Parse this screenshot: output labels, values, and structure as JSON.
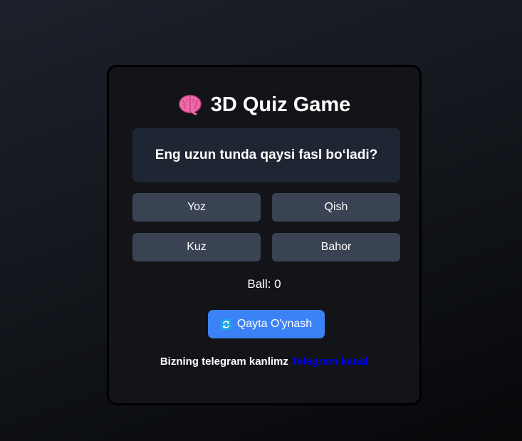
{
  "app": {
    "title": "3D Quiz Game",
    "title_icon": "brain-icon"
  },
  "question": {
    "text": "Eng uzun tunda qaysi fasl bo‘ladi?"
  },
  "answers": [
    {
      "label": "Yoz"
    },
    {
      "label": "Qish"
    },
    {
      "label": "Kuz"
    },
    {
      "label": "Bahor"
    }
  ],
  "score": {
    "text": "Ball: 0"
  },
  "restart": {
    "label": "Qayta O'ynash",
    "icon": "refresh-icon"
  },
  "footer": {
    "text": "Bizning telegram kanlimz",
    "link_label": "Telegram kanal"
  },
  "colors": {
    "card_bg": "#121418",
    "question_bg": "#1f2633",
    "answer_bg": "#3a4354",
    "button_accent": "#3b82f6",
    "link": "#0000ee"
  }
}
